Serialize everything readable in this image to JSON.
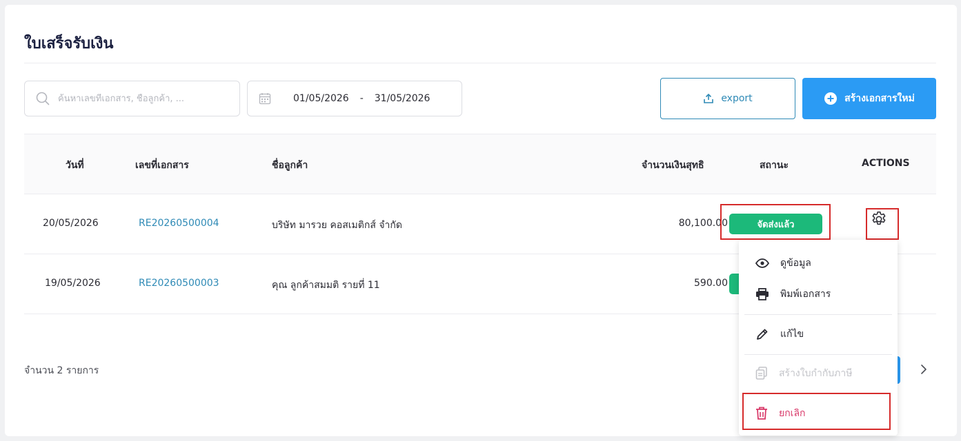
{
  "page": {
    "title": "ใบเสร็จรับเงิน"
  },
  "search": {
    "placeholder": "ค้นหาเลขที่เอกสาร, ชื่อลูกค้า, ..."
  },
  "date_range": {
    "start": "01/05/2026",
    "separator": "-",
    "end": "31/05/2026"
  },
  "toolbar": {
    "export_label": "export",
    "new_label": "สร้างเอกสารใหม่"
  },
  "table": {
    "headers": {
      "date": "วันที่",
      "doc_no": "เลขที่เอกสาร",
      "customer": "ชื่อลูกค้า",
      "amount": "จำนวนเงินสุทธิ",
      "status": "สถานะ",
      "actions": "ACTIONS"
    },
    "rows": [
      {
        "date": "20/05/2026",
        "doc_no": "RE20260500004",
        "customer": "บริษัท มารวย คอสเมติกส์ จำกัด",
        "amount": "80,100.00",
        "status": "จัดส่งแล้ว"
      },
      {
        "date": "19/05/2026",
        "doc_no": "RE20260500003",
        "customer": "คุณ ลูกค้าสมมติ รายที่ 11",
        "amount": "590.00",
        "status": ""
      }
    ]
  },
  "footer": {
    "count_text": "จำนวน 2 รายการ"
  },
  "action_menu": {
    "view": "ดูข้อมูล",
    "print": "พิมพ์เอกสาร",
    "edit": "แก้ไข",
    "tax_invoice": "สร้างใบกำกับภาษี",
    "cancel": "ยกเลิก"
  },
  "colors": {
    "primary": "#2b9bf4",
    "link": "#2f8ab6",
    "success": "#1cb97a",
    "danger": "#d93a6a",
    "highlight": "#d62b2b"
  },
  "icons": [
    "search-icon",
    "calendar-icon",
    "upload-icon",
    "plus-circle-icon",
    "gear-icon",
    "eye-icon",
    "printer-icon",
    "pencil-icon",
    "copy-icon",
    "trash-icon",
    "chevron-right-icon"
  ]
}
